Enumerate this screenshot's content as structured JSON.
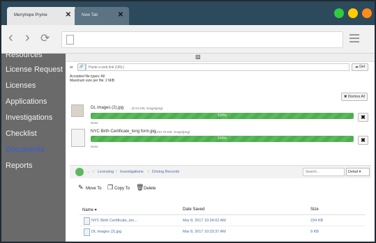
{
  "browser": {
    "tabs": [
      {
        "title": "Merryhope Pryme",
        "close": "✕"
      },
      {
        "title": "New Tab",
        "close": "✕"
      }
    ],
    "window_controls": {
      "colors": [
        "#2ecc40",
        "#ffcc00",
        "#ff8c1a"
      ]
    },
    "nav": {
      "back": "‹",
      "forward": "›",
      "reload": "⟳"
    }
  },
  "sidebar": {
    "items": [
      {
        "label": "Resources"
      },
      {
        "label": "License Request"
      },
      {
        "label": "Licenses"
      },
      {
        "label": "Applications"
      },
      {
        "label": "Investigations"
      },
      {
        "label": "Checklist"
      },
      {
        "label": "Documents",
        "active": true
      },
      {
        "label": "Reports"
      }
    ],
    "active_color": "#3b5bd6"
  },
  "upload": {
    "or_label": "or",
    "link_placeholder": "Paste a web link (URL)",
    "get_label": "Get",
    "accepted": "Accepted file types: All",
    "max_size": "Maximum size per file: 2 MiB",
    "dismiss_label": "Dismiss All",
    "files": [
      {
        "name": "DL images (2).jpg",
        "meta": "- (8.54 KiB, image/jpeg)",
        "progress_label": "100%",
        "status": "Done"
      },
      {
        "name": "NYC Birth Certificate_long form.jpg",
        "meta": "- (233.78 KiB, image/jpeg)",
        "progress_label": "100%",
        "status": "Done"
      }
    ]
  },
  "browser_panel": {
    "breadcrumb": [
      "...",
      "/",
      "Licensing",
      "/",
      "Investigations",
      "/",
      "Driving Records"
    ],
    "search_placeholder": "Search...",
    "view_select": "Detail",
    "actions": {
      "move": "Move To",
      "copy": "Copy To",
      "delete": "Delete"
    },
    "columns": {
      "name": "Name ▾",
      "date": "Date Saved",
      "size": "Size"
    },
    "rows": [
      {
        "name": "NYC Birth Certificate_lon...",
        "date": "Mar 8, 2017 10:34:02 AM",
        "size": "234 KB"
      },
      {
        "name": "DL images (2).jpg",
        "date": "Mar 8, 2017 10:33:37 AM",
        "size": "9 KB"
      }
    ]
  }
}
